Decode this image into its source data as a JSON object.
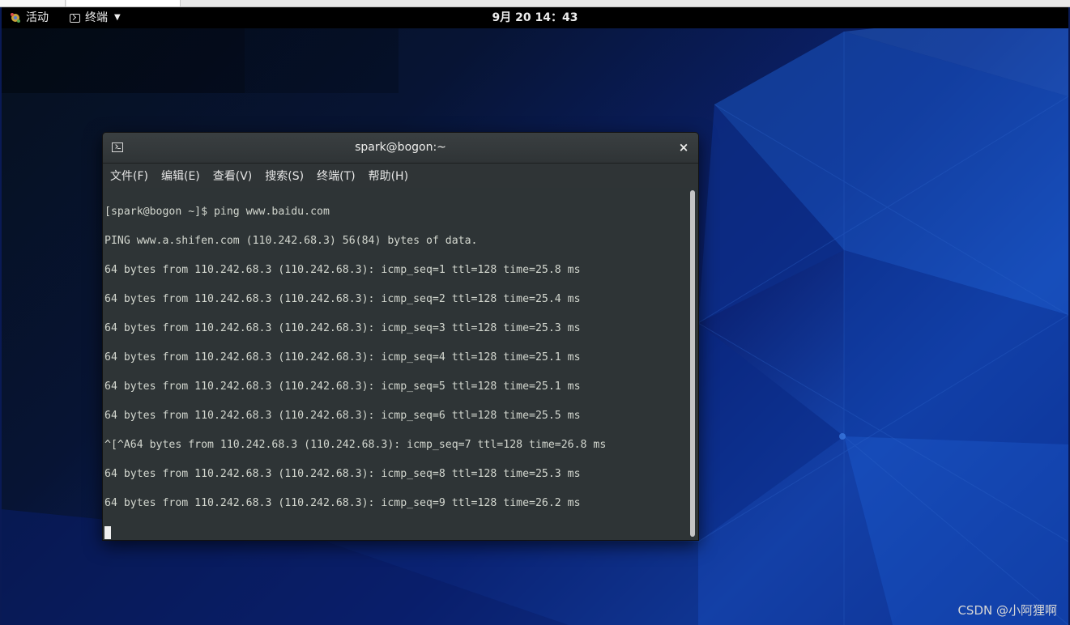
{
  "topbar": {
    "activities_label": "活动",
    "app_menu_label": "终端",
    "clock": "9月 20  14：43"
  },
  "window": {
    "title": "spark@bogon:~",
    "close_label": "×",
    "menus": [
      "文件(F)",
      "编辑(E)",
      "查看(V)",
      "搜索(S)",
      "终端(T)",
      "帮助(H)"
    ]
  },
  "terminal": {
    "lines": [
      "[spark@bogon ~]$ ping www.baidu.com",
      "PING www.a.shifen.com (110.242.68.3) 56(84) bytes of data.",
      "64 bytes from 110.242.68.3 (110.242.68.3): icmp_seq=1 ttl=128 time=25.8 ms",
      "64 bytes from 110.242.68.3 (110.242.68.3): icmp_seq=2 ttl=128 time=25.4 ms",
      "64 bytes from 110.242.68.3 (110.242.68.3): icmp_seq=3 ttl=128 time=25.3 ms",
      "64 bytes from 110.242.68.3 (110.242.68.3): icmp_seq=4 ttl=128 time=25.1 ms",
      "64 bytes from 110.242.68.3 (110.242.68.3): icmp_seq=5 ttl=128 time=25.1 ms",
      "64 bytes from 110.242.68.3 (110.242.68.3): icmp_seq=6 ttl=128 time=25.5 ms",
      "^[^A64 bytes from 110.242.68.3 (110.242.68.3): icmp_seq=7 ttl=128 time=26.8 ms",
      "64 bytes from 110.242.68.3 (110.242.68.3): icmp_seq=8 ttl=128 time=25.3 ms",
      "64 bytes from 110.242.68.3 (110.242.68.3): icmp_seq=9 ttl=128 time=26.2 ms"
    ]
  },
  "watermark": "CSDN @小阿狸啊",
  "colors": {
    "topbar_bg": "#000000",
    "terminal_bg": "#2e3436",
    "terminal_fg": "#d3d7cf",
    "desktop_accent": "#1546b0"
  }
}
